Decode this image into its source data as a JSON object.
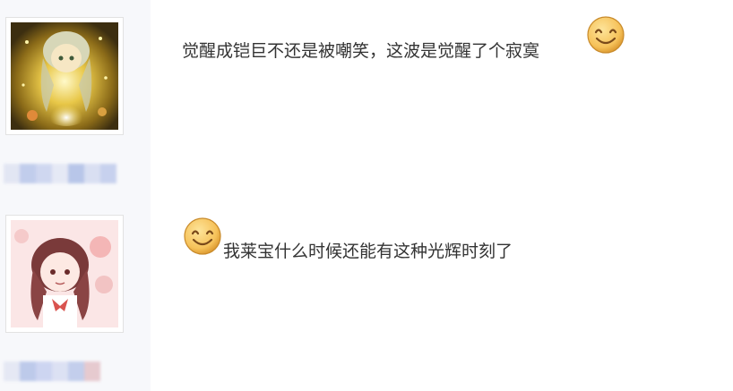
{
  "comments": [
    {
      "text_before_emoji": "觉醒成铠巨不还是被嘲笑，这波是觉醒了个寂寞",
      "text_after_emoji": "",
      "emoji": "smile-emoji",
      "avatar": "yellow-glow-anime-avatar",
      "username_blurred": true
    },
    {
      "text_before_emoji": "",
      "text_after_emoji": "我莱宝什么时候还能有这种光辉时刻了",
      "emoji": "smile-emoji",
      "avatar": "pink-anime-girl-avatar",
      "username_blurred": true
    }
  ],
  "colors": {
    "text": "#333333",
    "sidebar_bg": "#f7f8fb",
    "emoji_face": "#f6c25a"
  }
}
